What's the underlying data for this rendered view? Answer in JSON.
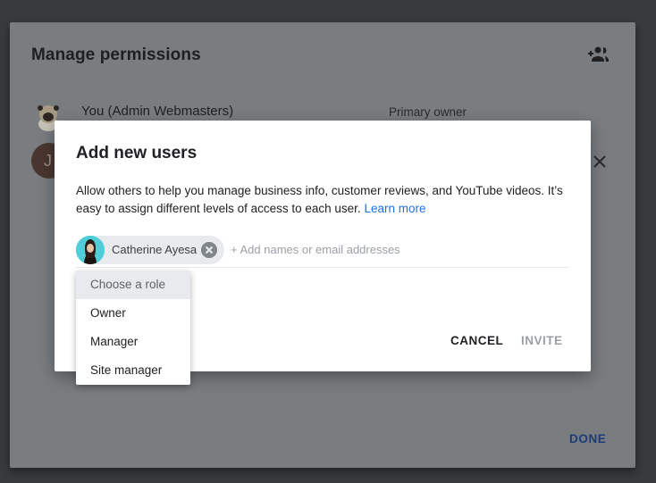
{
  "background_dialog": {
    "title": "Manage permissions",
    "add_users_icon": "person-add-icon",
    "users": [
      {
        "name": "You (Admin Webmasters)",
        "role": "Primary owner",
        "avatar": "pug-photo"
      },
      {
        "initial": "J",
        "remove_icon": "close-icon"
      }
    ],
    "done_label": "DONE"
  },
  "add_users_dialog": {
    "title": "Add new users",
    "description": "Allow others to help you manage business info, customer reviews, and YouTube videos. It’s easy to assign different levels of access to each user.",
    "learn_more": "Learn more",
    "chip": {
      "name": "Catherine Ayesa",
      "remove_icon": "cancel-circle-icon"
    },
    "input_placeholder": "+ Add names or email addresses",
    "cancel_label": "CANCEL",
    "invite_label": "INVITE"
  },
  "role_menu": {
    "header": "Choose a role",
    "options": [
      "Owner",
      "Manager",
      "Site manager"
    ]
  },
  "colors": {
    "link": "#1a73e8",
    "done": "#1f3a7a",
    "disabled": "#9aa0a6"
  }
}
